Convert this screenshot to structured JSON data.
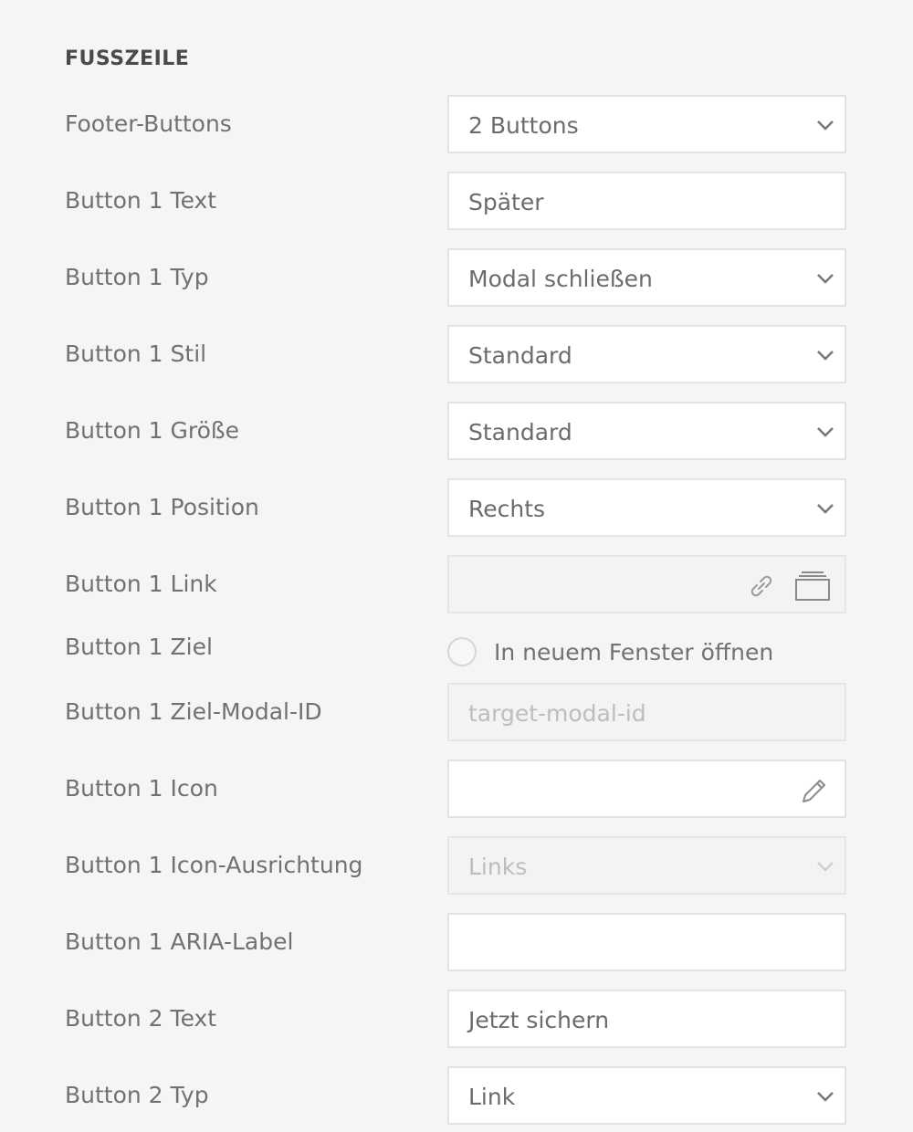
{
  "section": {
    "title": "FUSSZEILE"
  },
  "rows": [
    {
      "label": "Footer-Buttons",
      "value": "2 Buttons"
    },
    {
      "label": "Button 1 Text",
      "value": "Später"
    },
    {
      "label": "Button 1 Typ",
      "value": "Modal schließen"
    },
    {
      "label": "Button 1 Stil",
      "value": "Standard"
    },
    {
      "label": "Button 1 Größe",
      "value": "Standard"
    },
    {
      "label": "Button 1 Position",
      "value": "Rechts"
    },
    {
      "label": "Button 1 Link",
      "value": ""
    },
    {
      "label": "Button 1 Ziel",
      "option": "In neuem Fenster öffnen",
      "checked": false
    },
    {
      "label": "Button 1 Ziel-Modal-ID",
      "value": "",
      "placeholder": "target-modal-id"
    },
    {
      "label": "Button 1 Icon",
      "value": ""
    },
    {
      "label": "Button 1 Icon-Ausrichtung",
      "value": "Links"
    },
    {
      "label": "Button 1 ARIA-Label",
      "value": ""
    },
    {
      "label": "Button 2 Text",
      "value": "Jetzt sichern"
    },
    {
      "label": "Button 2 Typ",
      "value": "Link"
    }
  ],
  "icons": {
    "select": "chevron-down-icon",
    "link": "link-icon",
    "browse": "window-icon",
    "edit": "pencil-icon"
  }
}
